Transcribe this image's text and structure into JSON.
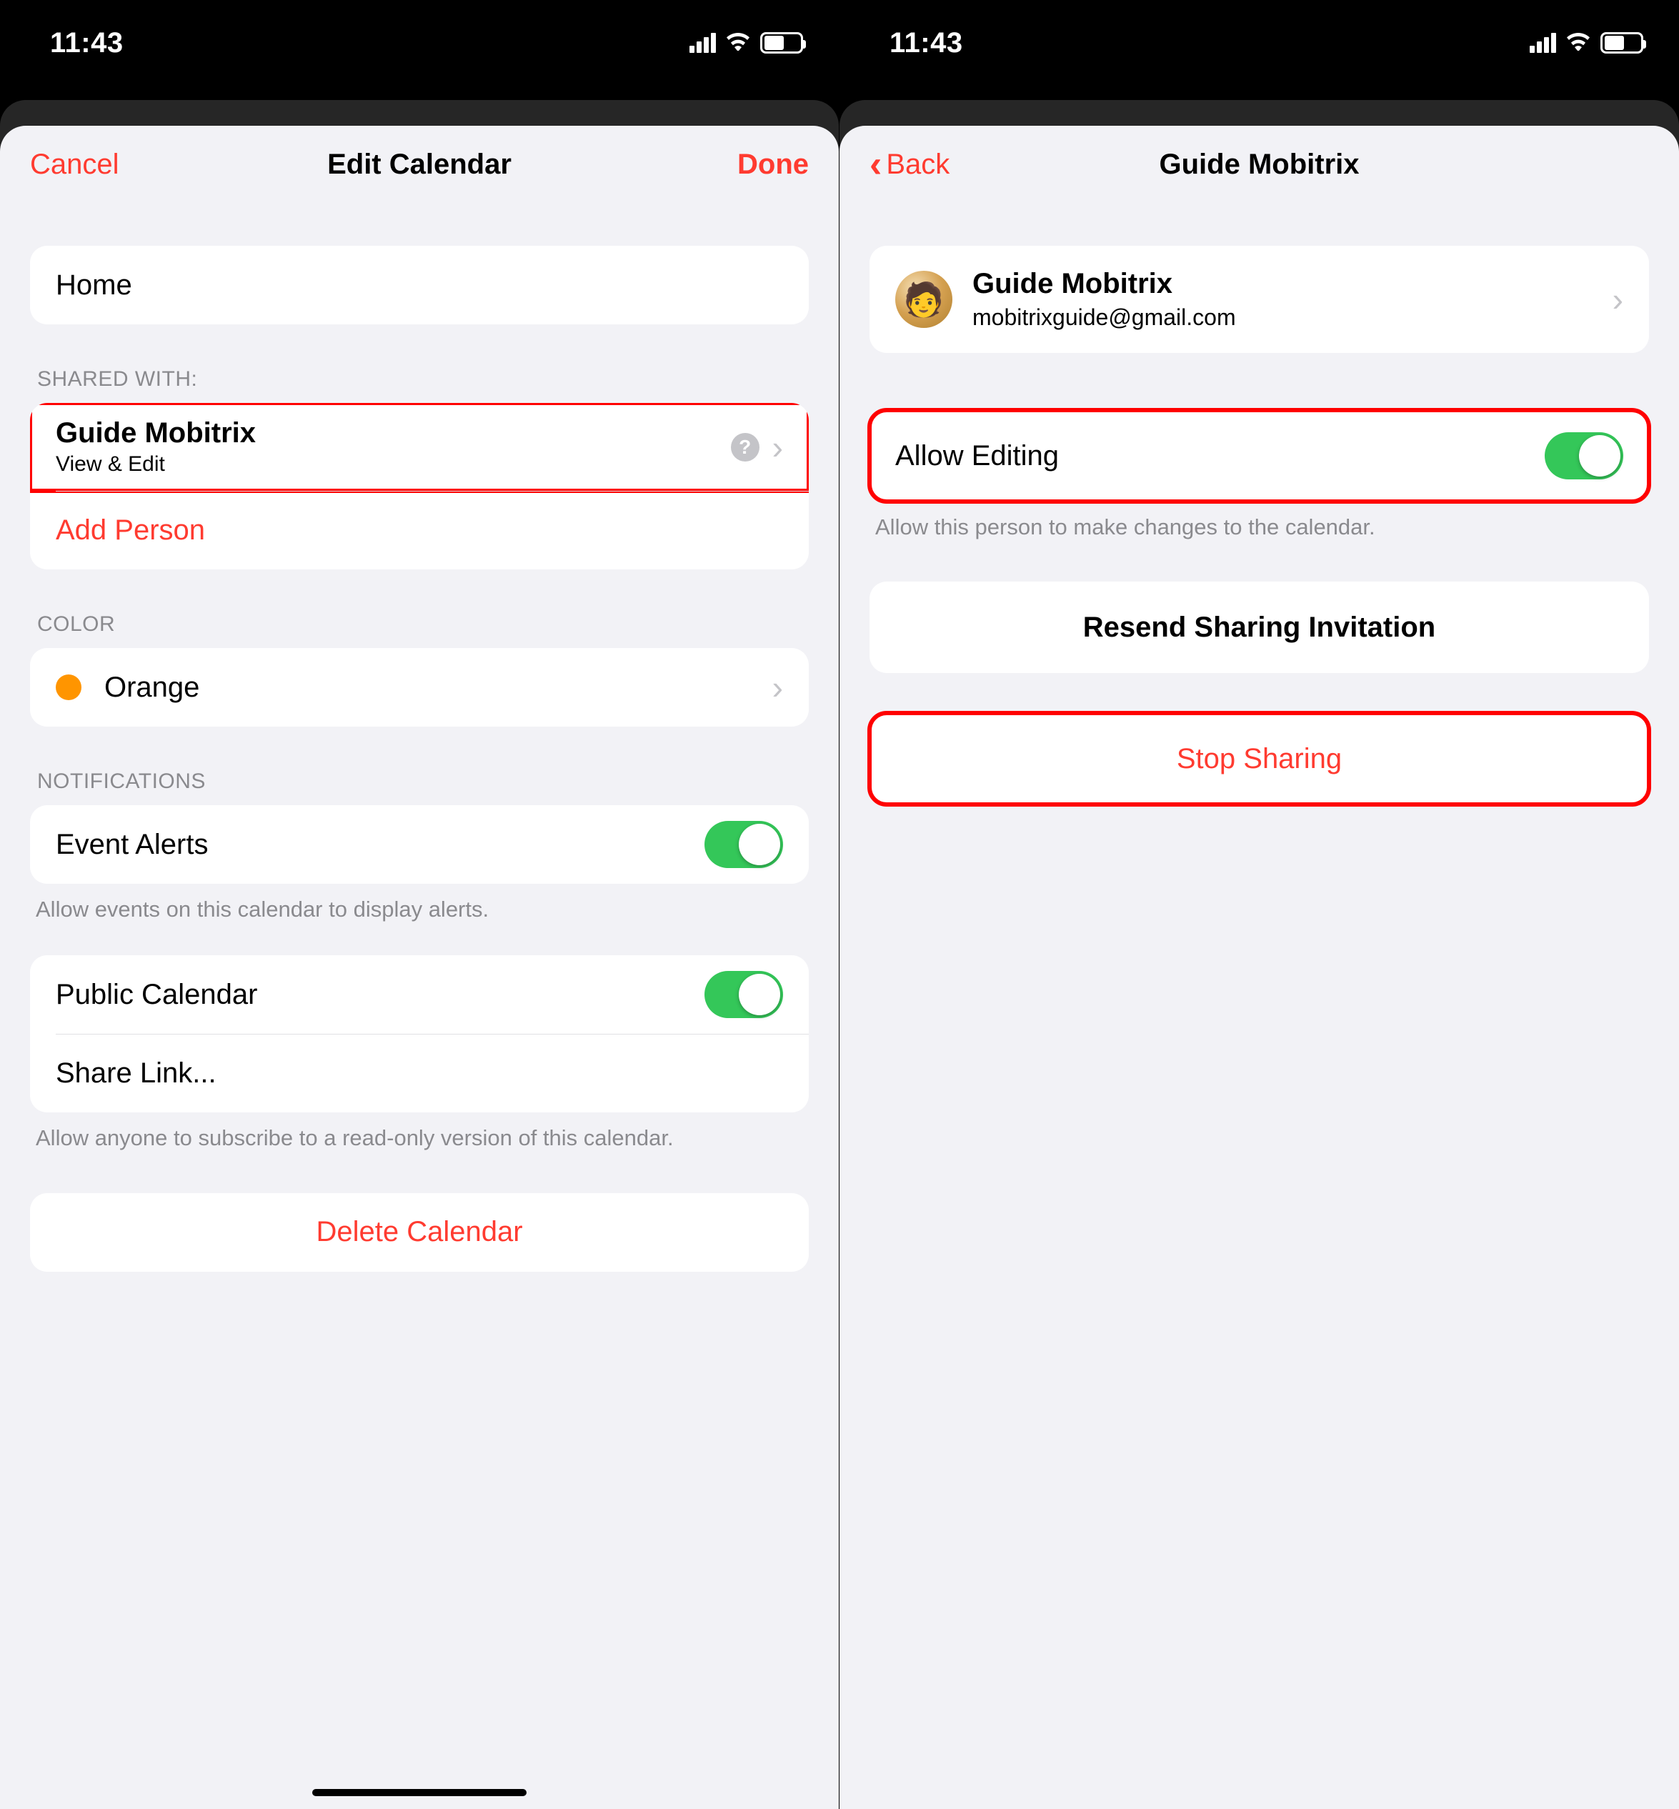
{
  "statusbar": {
    "time": "11:43"
  },
  "left": {
    "nav": {
      "cancel": "Cancel",
      "title": "Edit Calendar",
      "done": "Done"
    },
    "calendar_name": "Home",
    "shared_header": "Shared With:",
    "shared_person": {
      "name": "Guide  Mobitrix",
      "permission": "View & Edit"
    },
    "add_person": "Add Person",
    "color_header": "Color",
    "color_name": "Orange",
    "color_hex": "#ff9500",
    "notifications_header": "Notifications",
    "event_alerts": "Event Alerts",
    "event_alerts_footer": "Allow events on this calendar to display alerts.",
    "public_calendar": "Public Calendar",
    "share_link": "Share Link...",
    "public_footer": "Allow anyone to subscribe to a read-only version of this calendar.",
    "delete": "Delete Calendar"
  },
  "right": {
    "nav": {
      "back": "Back",
      "title": "Guide  Mobitrix"
    },
    "person": {
      "name": "Guide  Mobitrix",
      "email": "mobitrixguide@gmail.com"
    },
    "allow_editing": "Allow Editing",
    "allow_editing_footer": "Allow this person to make changes to the calendar.",
    "resend": "Resend Sharing Invitation",
    "stop": "Stop Sharing"
  }
}
